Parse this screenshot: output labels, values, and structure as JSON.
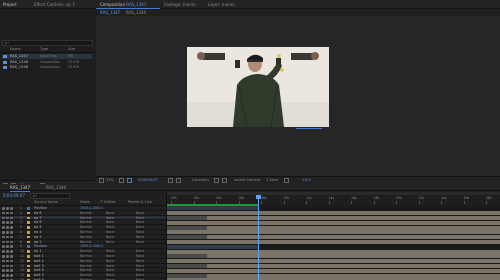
{
  "top_tabs": {
    "project": "Project",
    "effect_controls": "Effect Controls: ep 7",
    "composition": "Composition",
    "composition_name": "RAS_1347",
    "footage": "Footage: (none)",
    "layer": "Layer: (none)"
  },
  "comp_subtabs": [
    "RAS_1347",
    "RAS_1346"
  ],
  "project": {
    "search_placeholder": "ρ•",
    "columns": {
      "name": "Name",
      "type": "Type",
      "size": "Size"
    },
    "items": [
      {
        "name": "RAS_1347",
        "type": "QuickTime",
        "size": "MB",
        "selected": true
      },
      {
        "name": "RAS_1346",
        "type": "Composition",
        "size": "23.976"
      },
      {
        "name": "RAS_1348",
        "type": "Composition",
        "size": "23.976"
      }
    ],
    "bpc": "8 bpc"
  },
  "viewer": {
    "zoom": "33%",
    "timecode": "0;00;09;07",
    "resolution": "(Quarter)",
    "camera": "Active Camera",
    "views": "1 View",
    "offset": "+0.0"
  },
  "timeline": {
    "tabs": [
      "RAS_1347",
      "RAS_1346"
    ],
    "timecode": "0;00;09;07",
    "search_placeholder": "ρ•",
    "columns": {
      "layer_name": "Source Name",
      "mode": "Mode",
      "trkmat": "T TrkMat",
      "parent": "Parent & Link"
    },
    "ruler_ticks": [
      "00s",
      "02s",
      "04s",
      "06s",
      "08s",
      "10s",
      "12s",
      "14s",
      "16s",
      "18s",
      "20s",
      "22s",
      "24s",
      "26s",
      "28s"
    ],
    "layers": [
      {
        "num": "1",
        "name": "Position",
        "mode": "",
        "trk": "",
        "parent": "",
        "value": "1920.0,1062.0",
        "label": "#3d6fb0",
        "group": true
      },
      {
        "num": "2",
        "name": "ep 8",
        "mode": "Normal",
        "trk": "None",
        "parent": "None",
        "label": "#c9a23a"
      },
      {
        "num": "3",
        "name": "ep 7",
        "mode": "Normal",
        "trk": "None",
        "parent": "None",
        "label": "#c9a23a",
        "selected": true
      },
      {
        "num": "4",
        "name": "ep 6",
        "mode": "Normal",
        "trk": "None",
        "parent": "None",
        "label": "#c9a23a"
      },
      {
        "num": "5",
        "name": "ep 5",
        "mode": "Normal",
        "trk": "None",
        "parent": "None",
        "label": "#c9a23a"
      },
      {
        "num": "6",
        "name": "ep 4",
        "mode": "Normal",
        "trk": "None",
        "parent": "None",
        "label": "#c9a23a"
      },
      {
        "num": "7",
        "name": "ep 3",
        "mode": "Normal",
        "trk": "None",
        "parent": "None",
        "label": "#c9a23a"
      },
      {
        "num": "8",
        "name": "ep 2",
        "mode": "Normal",
        "trk": "None",
        "parent": "None",
        "label": "#c9a23a"
      },
      {
        "num": "9",
        "name": "Position",
        "mode": "",
        "trk": "",
        "parent": "",
        "value": "1920.0,1062.0",
        "label": "#3d6fb0",
        "group": true
      },
      {
        "num": "10",
        "name": "ep 1",
        "mode": "Normal",
        "trk": "None",
        "parent": "None",
        "label": "#c9a23a"
      },
      {
        "num": "11",
        "name": "bolt 1",
        "mode": "Normal",
        "trk": "None",
        "parent": "None",
        "label": "#c9a23a"
      },
      {
        "num": "12",
        "name": "bolt 2",
        "mode": "Normal",
        "trk": "None",
        "parent": "None",
        "label": "#c9a23a"
      },
      {
        "num": "13",
        "name": "bolt 3",
        "mode": "Normal",
        "trk": "None",
        "parent": "None",
        "label": "#c9a23a"
      },
      {
        "num": "14",
        "name": "bolt 4",
        "mode": "Normal",
        "trk": "None",
        "parent": "None",
        "label": "#c9a23a"
      },
      {
        "num": "15",
        "name": "bolt 5",
        "mode": "Normal",
        "trk": "None",
        "parent": "None",
        "label": "#c9a23a"
      },
      {
        "num": "16",
        "name": "bolt 6",
        "mode": "Normal",
        "trk": "None",
        "parent": "None",
        "label": "#c9a23a"
      }
    ]
  },
  "colors": {
    "accent": "#3d7ed8",
    "playhead": "#5aa0ff",
    "work_area": "#2a8f3a",
    "bar": "#7b7468"
  }
}
